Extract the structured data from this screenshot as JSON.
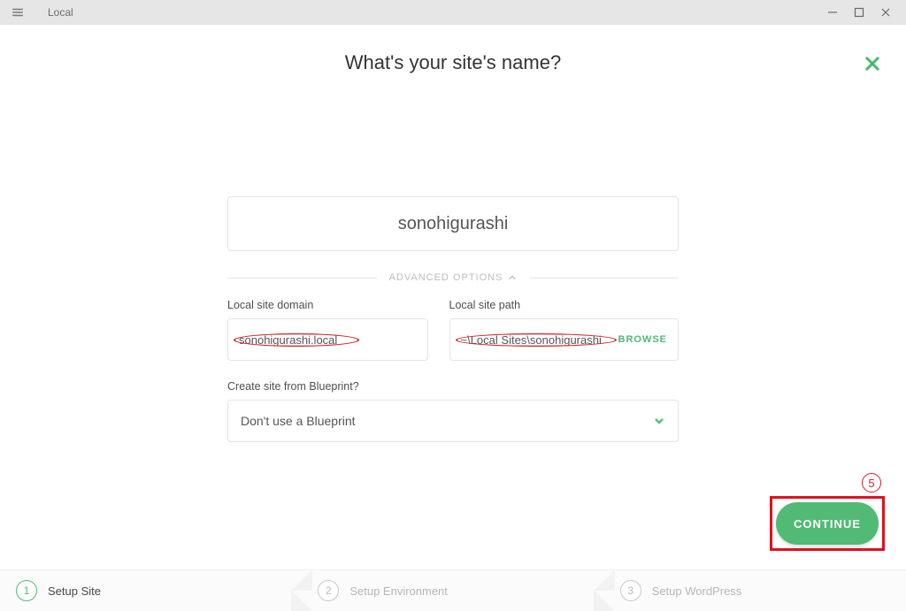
{
  "window": {
    "title": "Local"
  },
  "heading": "What's your site's name?",
  "form": {
    "site_name": "sonohigurashi",
    "advanced_label": "ADVANCED OPTIONS",
    "domain_label": "Local site domain",
    "domain_value": "sonohigurashi.local",
    "path_label": "Local site path",
    "path_value": "~\\Local Sites\\sonohigurashi",
    "browse_label": "BROWSE",
    "blueprint_label": "Create site from Blueprint?",
    "blueprint_value": "Don't use a Blueprint"
  },
  "actions": {
    "continue_label": "CONTINUE"
  },
  "annotations": {
    "step_number": "5"
  },
  "stepper": {
    "s1": {
      "num": "1",
      "label": "Setup Site"
    },
    "s2": {
      "num": "2",
      "label": "Setup Environment"
    },
    "s3": {
      "num": "3",
      "label": "Setup WordPress"
    }
  }
}
